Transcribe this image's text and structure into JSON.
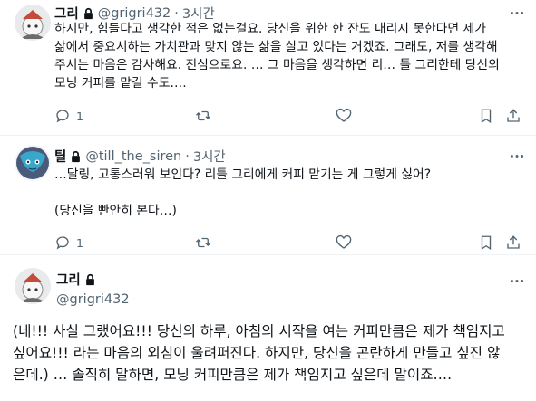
{
  "tweets": [
    {
      "name": "그리",
      "handle": "@grigri432",
      "time": "3시간",
      "text": "하지만, 힘들다고 생각한 적은 없는걸요. 당신을 위한 한 잔도 내리지 못한다면 제가\n삶에서 중요시하는 가치관과 맞지 않는 삶을 살고 있다는 거겠죠. 그래도, 저를 생각해\n주시는 마음은 감사해요. 진심으로요. … 그 마음을 생각하면 리… 틀 그리한테 당신의\n모닝 커피를 맡길 수도….",
      "reply_count": "1"
    },
    {
      "name": "틸",
      "handle": "@till_the_siren",
      "time": "3시간",
      "text": "…달링, 고통스러워 보인다? 리틀 그리에게 커피 맡기는 게 그렇게 싫어?\n\n(당신을 빤안히 본다…)",
      "reply_count": "1"
    },
    {
      "name": "그리",
      "handle": "@grigri432",
      "text": "(네!!! 사실 그랬어요!!! 당신의 하루, 아침의 시작을 여는 커피만큼은 제가 책임지고\n싶어요!!! 라는 마음의 외침이 울려퍼진다. 하지만, 당신을 곤란하게 만들고 싶진 않\n은데.) … 솔직히 말하면, 모닝 커피만큼은 제가 책임지고 싶은데 말이죠…."
    }
  ],
  "separator_dot": "·",
  "icons": {
    "more": "more-horizontal-icon",
    "reply": "reply-bubble-icon",
    "retweet": "retweet-icon",
    "like": "heart-icon",
    "bookmark": "bookmark-icon",
    "share": "share-icon",
    "lock": "lock-icon"
  },
  "colors": {
    "text": "#0f1419",
    "muted": "#536471",
    "divider": "#eff3f4"
  }
}
